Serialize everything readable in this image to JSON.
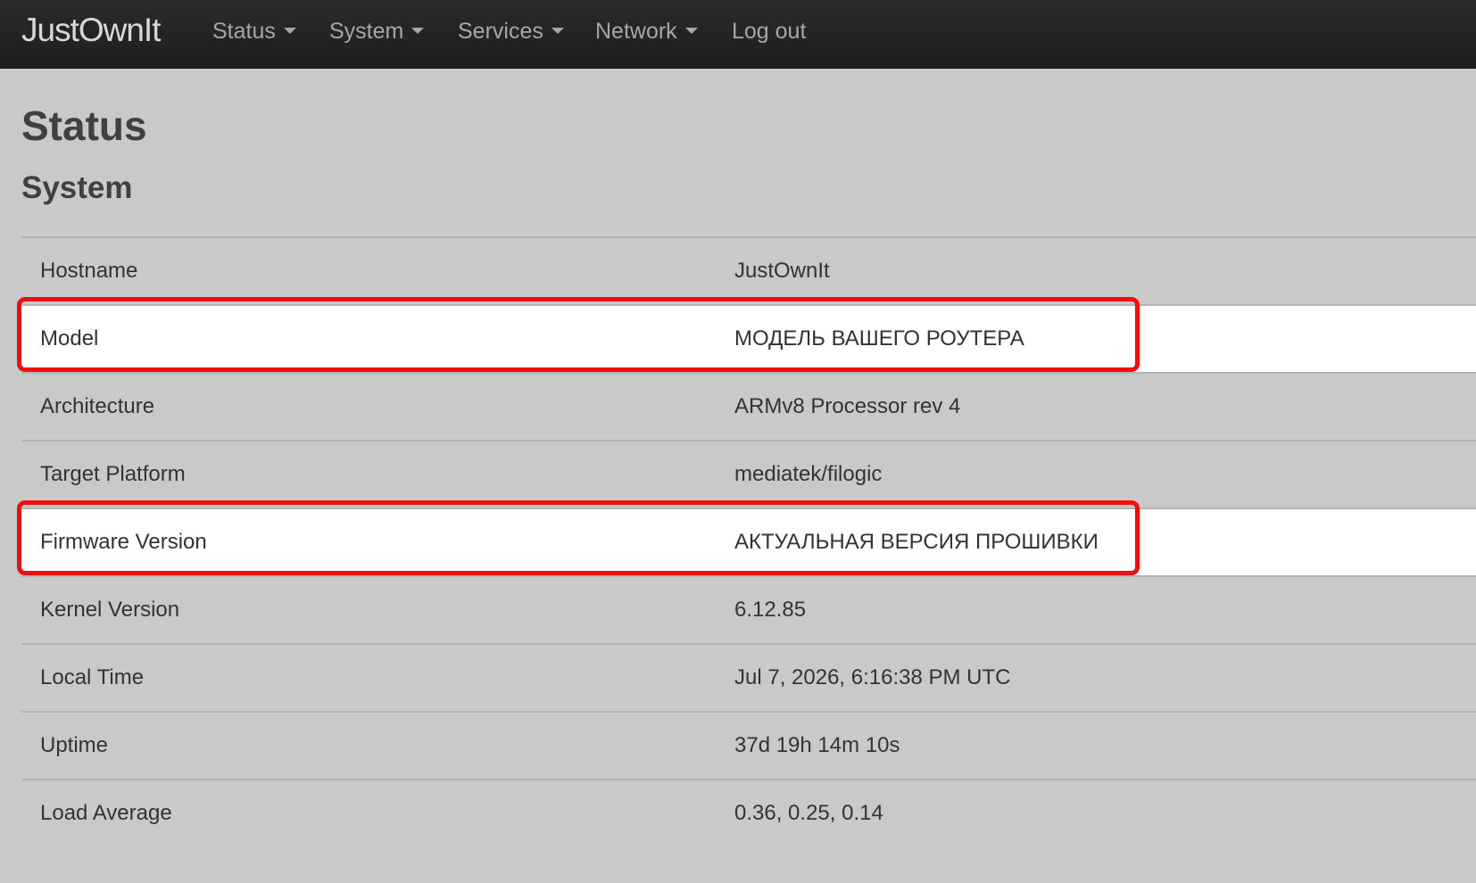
{
  "navbar": {
    "brand": "JustOwnIt",
    "items": [
      {
        "label": "Status",
        "dropdown": true
      },
      {
        "label": "System",
        "dropdown": true
      },
      {
        "label": "Services",
        "dropdown": true
      },
      {
        "label": "Network",
        "dropdown": true
      },
      {
        "label": "Log out",
        "dropdown": false
      }
    ]
  },
  "page": {
    "title": "Status",
    "section_title": "System"
  },
  "system_info": [
    {
      "label": "Hostname",
      "value": "JustOwnIt",
      "highlighted": false
    },
    {
      "label": "Model",
      "value": "МОДЕЛЬ ВАШЕГО РОУТЕРА",
      "highlighted": true
    },
    {
      "label": "Architecture",
      "value": "ARMv8 Processor rev 4",
      "highlighted": false
    },
    {
      "label": "Target Platform",
      "value": "mediatek/filogic",
      "highlighted": false
    },
    {
      "label": "Firmware Version",
      "value": "АКТУАЛЬНАЯ ВЕРСИЯ ПРОШИВКИ",
      "highlighted": true
    },
    {
      "label": "Kernel Version",
      "value": "6.12.85",
      "highlighted": false
    },
    {
      "label": "Local Time",
      "value": "Jul 7, 2026, 6:16:38 PM UTC",
      "highlighted": false
    },
    {
      "label": "Uptime",
      "value": "37d 19h 14m 10s",
      "highlighted": false
    },
    {
      "label": "Load Average",
      "value": "0.36, 0.25, 0.14",
      "highlighted": false
    }
  ],
  "colors": {
    "navbar_bg": "#222222",
    "page_bg": "#c9c9c9",
    "highlight_row_bg": "#ffffff",
    "annotation_red": "#f20e0e"
  },
  "icons": {
    "dropdown": "caret-down-icon"
  }
}
